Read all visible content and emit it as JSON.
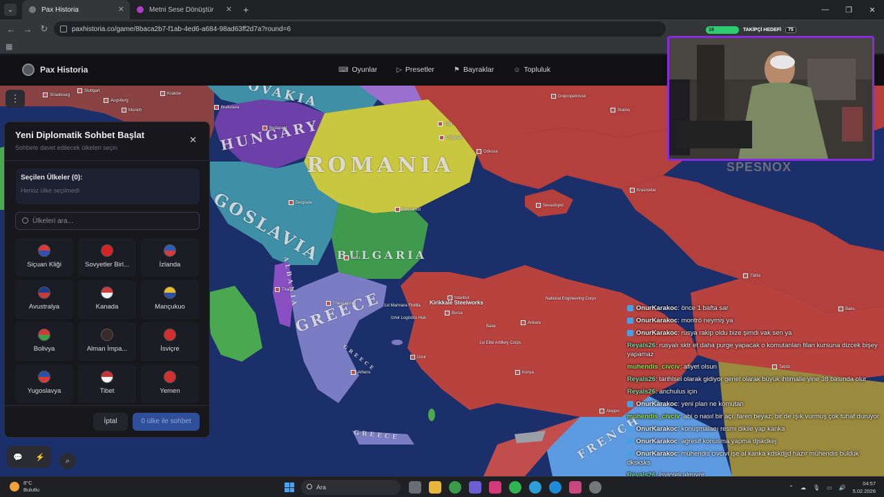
{
  "browser": {
    "tabs": [
      {
        "title": "Pax Historia",
        "active": true
      },
      {
        "title": "Metni Sese Dönüştür",
        "active": false
      }
    ],
    "url": "paxhistoria.co/game/8baca2b7-f1ab-4ed6-a684-98ad63ff2d7a?round=6"
  },
  "stream_hud": {
    "goal_value": "19",
    "goal_label": "TAKİPÇİ HEDEFİ",
    "goal_target": "75"
  },
  "site": {
    "logo": "Pax Historia",
    "nav": [
      {
        "label": "Oyunlar",
        "icon": "gamepad-icon"
      },
      {
        "label": "Presetler",
        "icon": "play-icon"
      },
      {
        "label": "Bayraklar",
        "icon": "flag-icon"
      },
      {
        "label": "Topluluk",
        "icon": "users-icon"
      }
    ]
  },
  "map": {
    "labels": {
      "slovakia": "OVAKIA",
      "hungary": "HUNGARY",
      "romania": "ROMANIA",
      "yugoslavia": "GOSLAVIA",
      "bulgaria": "BULGARIA",
      "albania": "ALBANIA",
      "greece": "GREECE",
      "greece2": "GREECE",
      "greece3": "GREECE",
      "french": "FRENCH"
    },
    "cities": {
      "stuttgart": "Stuttgart",
      "strasbourg": "Strasbourg",
      "augsburg": "Augsburg",
      "munich": "Munich",
      "bratislava": "Bratislava",
      "budapest": "Budapest",
      "belgrade": "Belgrade",
      "bucharest": "Bucharest",
      "sofia": "Sofia",
      "tirana": "Tirana",
      "athens": "Athens",
      "thessaloniki": "Thessaloniki",
      "istanbul": "Istanbul",
      "bursa": "Bursa",
      "ankara": "Ankara",
      "izmir": "Izmir",
      "konya": "Konya",
      "odessa": "Odessa",
      "sevastopol": "Sevastopol",
      "krasnodar": "Krasnodar",
      "dnipropetrovsk": "Dnipropetrovsk",
      "stalino": "Stalino",
      "chisinau": "Chişinău",
      "tbilisi": "Tbilisi",
      "baku": "Baku",
      "tabriz": "Tabriz",
      "aleppo": "Aleppo",
      "krakow": "Kraków",
      "oradea": "Cluj"
    },
    "pois": {
      "steelworks": "Kirikkale Steelworks",
      "flotilla": "1st Marmara Flotilla",
      "logistics": "Izmir Logistics Hub",
      "artillery": "1st Elite Artillery Corps",
      "base": "Base",
      "corps": "National Engineering Corps"
    }
  },
  "panel": {
    "title": "Yeni Diplomatik Sohbet Başlat",
    "subtitle": "Sohbete davet edilecek ülkeleri seçin",
    "selected_label": "Seçilen Ülkeler (0):",
    "selected_empty": "Henüz ülke seçilmedi",
    "search_placeholder": "Ülkeleri ara...",
    "countries": [
      {
        "name": "Siçuan Kliği",
        "colors": [
          "#d93a3a",
          "#2f4fb3"
        ]
      },
      {
        "name": "Sovyetler Birl...",
        "colors": [
          "#d42424",
          "#d42424"
        ]
      },
      {
        "name": "İzlanda",
        "colors": [
          "#2c5bb8",
          "#d63c3c"
        ]
      },
      {
        "name": "Avustralya",
        "colors": [
          "#1f3b8c",
          "#c83b3b"
        ]
      },
      {
        "name": "Kanada",
        "colors": [
          "#d33a3a",
          "#f2f2f2"
        ]
      },
      {
        "name": "Mançukuo",
        "colors": [
          "#e6c02c",
          "#2f4fa0"
        ]
      },
      {
        "name": "Bolivya",
        "colors": [
          "#d33a3a",
          "#3fa048"
        ]
      },
      {
        "name": "Alman İmpa...",
        "colors": [
          "#3a2a2a",
          "#3a2a2a"
        ]
      },
      {
        "name": "İsviçre",
        "colors": [
          "#d42d2d",
          "#d42d2d"
        ]
      },
      {
        "name": "Yugoslavya",
        "colors": [
          "#2a4fa6",
          "#d33a3a"
        ]
      },
      {
        "name": "Tibet",
        "colors": [
          "#c83434",
          "#f4f4f4"
        ]
      },
      {
        "name": "Yemen",
        "colors": [
          "#d33030",
          "#d33030"
        ]
      }
    ],
    "cancel": "İptal",
    "start": "0 ülke ile sohbet"
  },
  "webcam_brand": "SPESNOX",
  "chat": [
    {
      "user": "OnurKarakoc",
      "color": "#f2f2f4",
      "badge": true,
      "text": ": önce 1 bafta sar"
    },
    {
      "user": "OnurKarakoc",
      "color": "#f2f2f4",
      "badge": true,
      "text": ": montrö neymiş ya"
    },
    {
      "user": "OnurKarakoc",
      "color": "#f2f2f4",
      "badge": true,
      "text": ": rusya rakip oldu bize şimdi vak sen ya"
    },
    {
      "user": "Reyals26",
      "color": "#7bd6a3",
      "badge": false,
      "text": ": rusyalı sktr et daha purge yapacak o komutanları filan kursuna dizcek bişey yapamaz"
    },
    {
      "user": "muhendis_civciv",
      "color": "#9be04a",
      "badge": false,
      "text": ": afiyet olsun"
    },
    {
      "user": "Reyals26",
      "color": "#7bd6a3",
      "badge": false,
      "text": ": tarihlsel olarak gidiyor genel olarak büyük ihtimalle yine 38 basında olur"
    },
    {
      "user": "Reyals26",
      "color": "#7bd6a3",
      "badge": false,
      "text": ": anchulus için"
    },
    {
      "user": "OnurKarakoc",
      "color": "#f2f2f4",
      "badge": true,
      "text": ": yeni plan ne komutan"
    },
    {
      "user": "muhendis_civciv",
      "color": "#9be04a",
      "badge": false,
      "text": ": abi o nasıl bir açı, faren beyaz, bir de ışık vurmuş çok tuhaf duruyor"
    },
    {
      "user": "OnurKarakoc",
      "color": "#f2f2f4",
      "badge": true,
      "text": ": konuşmalaeı resmi dikile yap kanka"
    },
    {
      "user": "OnurKarakoc",
      "color": "#f2f2f4",
      "badge": true,
      "text": ": agresif konusma yapma djskdkej"
    },
    {
      "user": "OnurKarakoc",
      "color": "#f2f2f4",
      "badge": true,
      "text": ": mühendis civcivi işe al kanka kdskdjjd hazır mühendis bulduk dksksks"
    },
    {
      "user": "Reyals26",
      "color": "#7bd6a3",
      "badge": false,
      "text": ": İşvicreli almıyor"
    }
  ],
  "taskbar": {
    "temp": "8°C",
    "weather": "Bulutlu",
    "search": "Ara",
    "time": "04:57",
    "date": "5.02.2026"
  }
}
